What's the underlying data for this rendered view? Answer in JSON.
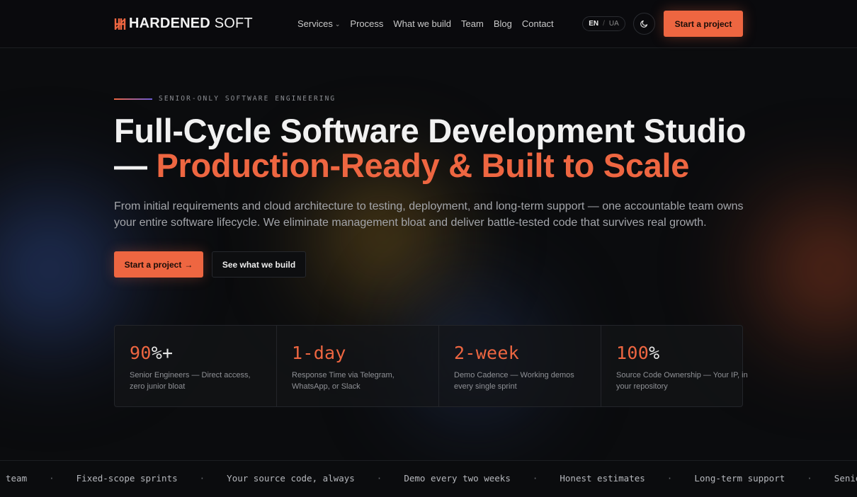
{
  "header": {
    "logo_bold": "HARDENED",
    "logo_light": " SOFT",
    "nav": [
      {
        "label": "Services",
        "has_dropdown": true
      },
      {
        "label": "Process"
      },
      {
        "label": "What we build"
      },
      {
        "label": "Team"
      },
      {
        "label": "Blog"
      },
      {
        "label": "Contact"
      }
    ],
    "lang_active": "EN",
    "lang_sep": "/",
    "lang_other": "UA",
    "theme_icon": "moon-icon",
    "cta_label": "Start a project"
  },
  "hero": {
    "eyebrow": "SENIOR-ONLY SOFTWARE ENGINEERING",
    "title_line1": "Full-Cycle Software Development Studio",
    "title_dash": "— ",
    "title_accent": "Production-Ready & Built to Scale",
    "lead": "From initial requirements and cloud architecture to testing, deployment, and long-term support — one accountable team owns your entire software lifecycle. We eliminate management bloat and deliver battle-tested code that survives real growth.",
    "primary_cta": "Start a project",
    "primary_cta_arrow": "→",
    "secondary_cta": "See what we build"
  },
  "stats": [
    {
      "value": "90",
      "suffix": "%+",
      "desc": "Senior Engineers — Direct access, zero junior bloat"
    },
    {
      "value": "1-day",
      "suffix": "",
      "desc": "Response Time via Telegram, WhatsApp, or Slack"
    },
    {
      "value": "2-week",
      "suffix": "",
      "desc": "Demo Cadence — Working demos every single sprint"
    },
    {
      "value": "100",
      "suffix": "%",
      "desc": "Source Code Ownership — Your IP, in your repository"
    }
  ],
  "ticker": {
    "separator": "·",
    "items": [
      "team",
      "Fixed-scope sprints",
      "Your source code, always",
      "Demo every two weeks",
      "Honest estimates",
      "Long-term support",
      "Senior-only t"
    ]
  },
  "colors": {
    "accent": "#ee6641",
    "background": "#0b0c0e",
    "text": "#f1f1f1",
    "muted": "#a3a5aa"
  }
}
